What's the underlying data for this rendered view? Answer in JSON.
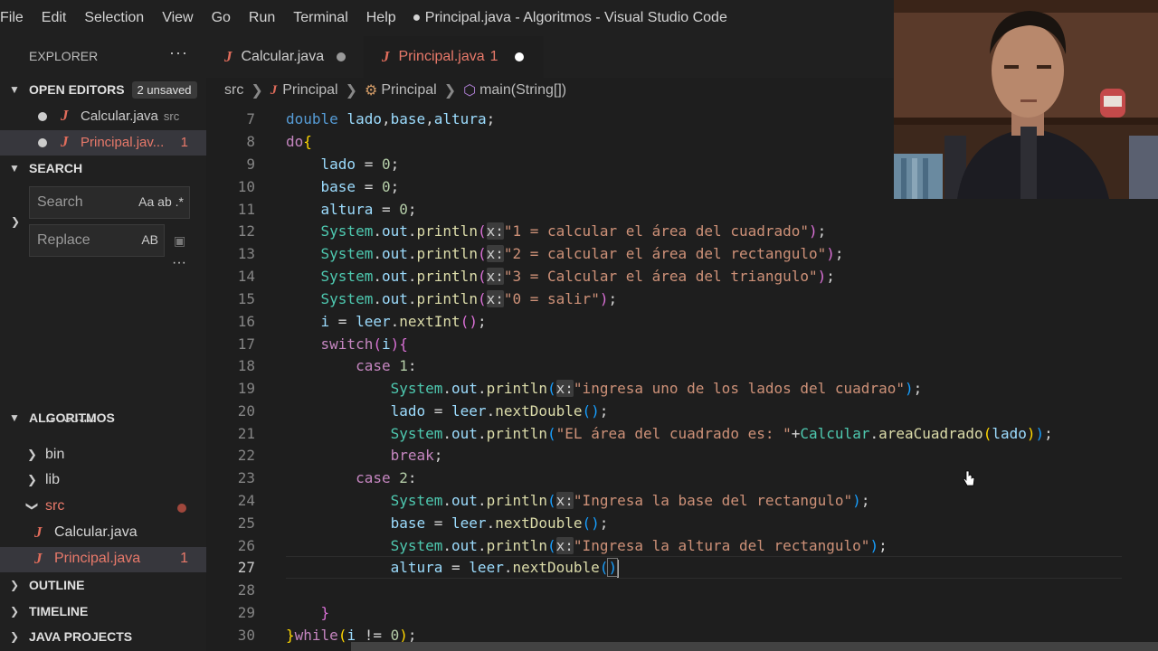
{
  "menu": [
    "File",
    "Edit",
    "Selection",
    "View",
    "Go",
    "Run",
    "Terminal",
    "Help"
  ],
  "window_title": "● Principal.java - Algoritmos - Visual Studio Code",
  "sidebar": {
    "header": "EXPLORER",
    "more": "···",
    "open_editors": {
      "title": "OPEN EDITORS",
      "badge": "2 unsaved",
      "items": [
        {
          "icon": "J",
          "name": "Calcular.java",
          "hint": "src",
          "problems": ""
        },
        {
          "icon": "J",
          "name": "Principal.jav...",
          "hint": "",
          "problems": "1"
        }
      ]
    },
    "search": {
      "title": "SEARCH",
      "search_placeholder": "Search",
      "search_options": "Aa  ab  .*",
      "replace_placeholder": "Replace",
      "replace_options": "AB",
      "more": "···"
    },
    "workspace": {
      "title": "ALGORITMOS",
      "items": [
        {
          "name": ".vscode"
        },
        {
          "name": "bin"
        },
        {
          "name": "lib"
        },
        {
          "name": "src"
        },
        {
          "name": "Calcular.java",
          "problems": ""
        },
        {
          "name": "Principal.java",
          "problems": "1"
        }
      ]
    },
    "outline": "OUTLINE",
    "timeline": "TIMELINE",
    "java_projects": "JAVA PROJECTS"
  },
  "tabs": [
    {
      "name": "Calcular.java",
      "problems": ""
    },
    {
      "name": "Principal.java",
      "problems": "1"
    }
  ],
  "breadcrumb": [
    "src",
    "Principal",
    "Principal",
    "main(String[])"
  ],
  "line_numbers": [
    "7",
    "8",
    "9",
    "10",
    "11",
    "12",
    "13",
    "14",
    "15",
    "16",
    "17",
    "18",
    "19",
    "20",
    "21",
    "22",
    "23",
    "24",
    "25",
    "26",
    "27",
    "28",
    "29",
    "30"
  ],
  "code": {
    "hint_x": "x:",
    "s1": "\"1 = calcular el área del cuadrado\"",
    "s2": "\"2 = calcular el área del rectangulo\"",
    "s3": "\"3 = Calcular el área del triangulo\"",
    "s0": "\"0 = salir\"",
    "s4": "\"ingresa uno de los lados del cuadrao\"",
    "s5": "\"EL área del cuadrado es: \"",
    "s6": "\"Ingresa la base del rectangulo\"",
    "s7": "\"Ingresa la altura del rectangulo\""
  }
}
